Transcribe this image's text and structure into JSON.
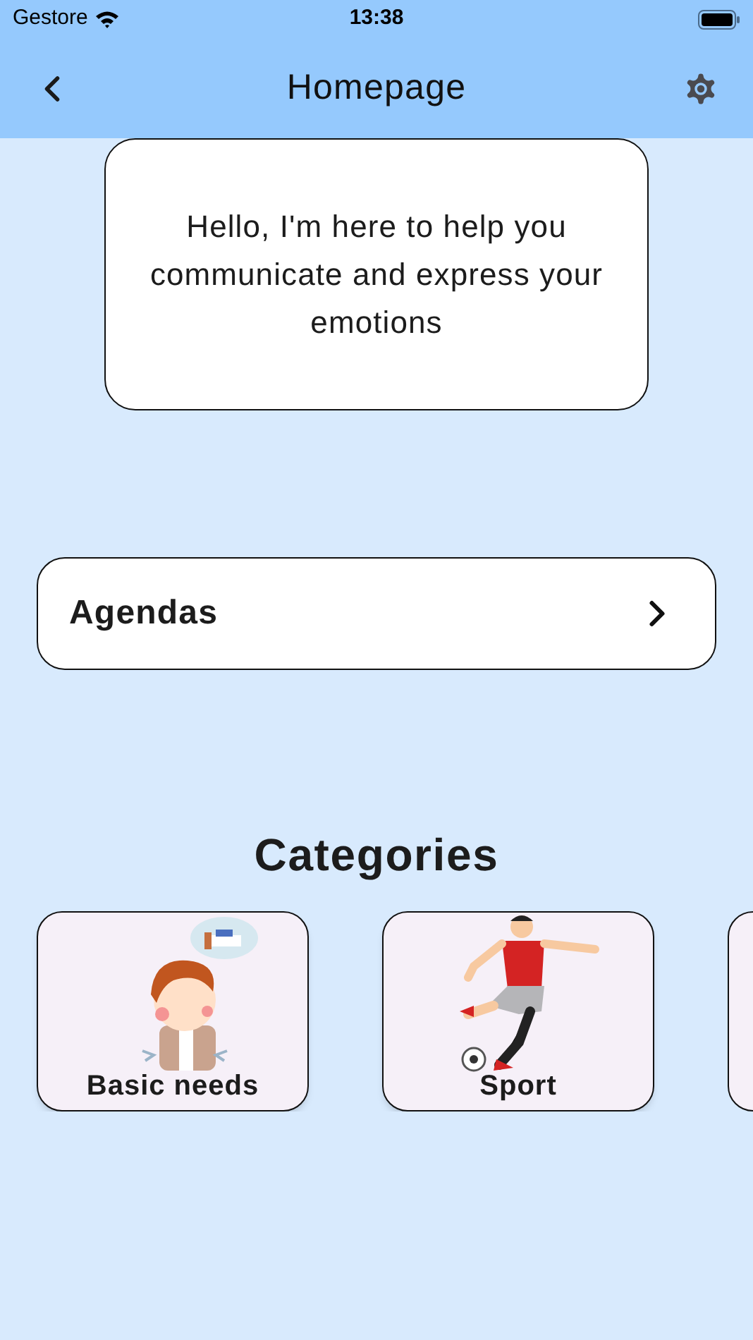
{
  "status_bar": {
    "carrier": "Gestore",
    "time": "13:38"
  },
  "nav_bar": {
    "title": "Homepage"
  },
  "welcome_message": "Hello, I'm here to help you communicate and express your emotions",
  "agendas": {
    "label": "Agendas"
  },
  "categories": {
    "title": "Categories",
    "items": [
      {
        "label": "Basic needs",
        "kind": "needs"
      },
      {
        "label": "Sport",
        "kind": "sport"
      }
    ]
  }
}
